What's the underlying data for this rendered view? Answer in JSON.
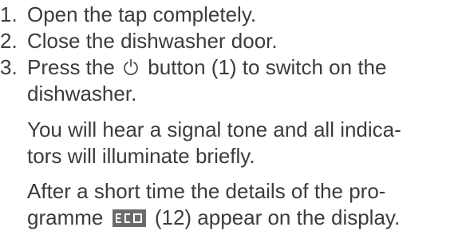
{
  "steps": [
    {
      "number": "1.",
      "text": "Open the tap completely."
    },
    {
      "number": "2.",
      "text": "Close the dishwasher door."
    },
    {
      "number": "3.",
      "text_before_icon": "Press the",
      "icon": "power-button-icon",
      "text_after_icon": "button (1) to switch on the",
      "continuation": "dishwasher."
    }
  ],
  "paragraph_1": {
    "line_1": "You will hear a signal tone and all indica-",
    "line_2": "tors will illuminate briefly."
  },
  "paragraph_2": {
    "line_1": "After a short time the details of the pro-",
    "line_2_before_icon": "gramme",
    "icon": "eco-programme-icon",
    "line_2_after_icon": "(12) appear on the display."
  },
  "colors": {
    "text": "#3c3c3c",
    "icon_background": "#6b6b6b",
    "icon_foreground": "#ffffff"
  }
}
